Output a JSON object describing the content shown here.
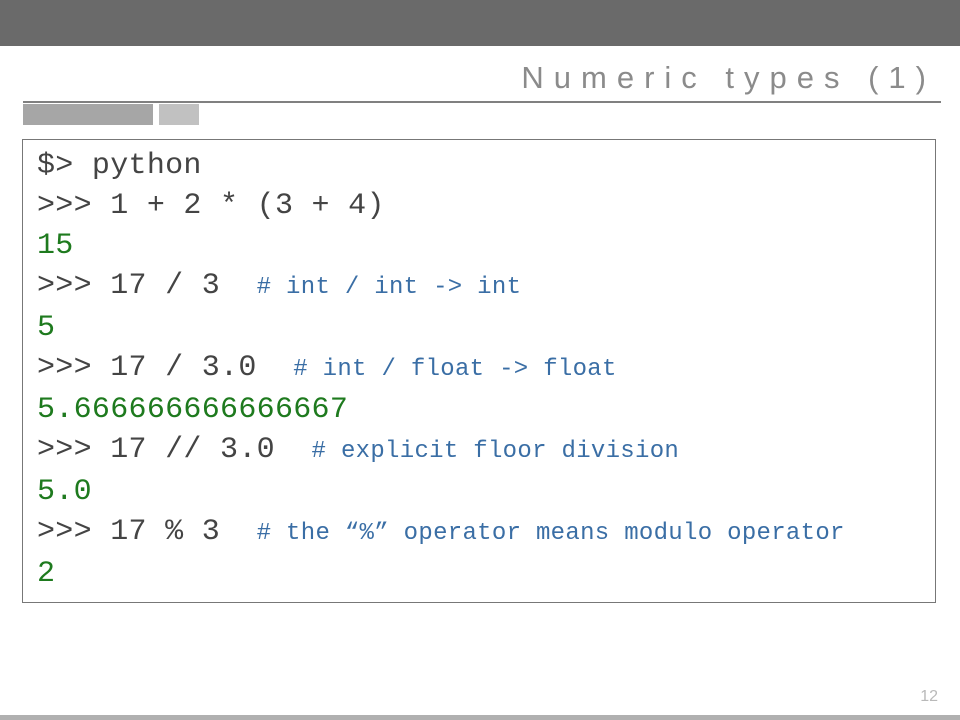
{
  "title": "Numeric types (1)",
  "page_number": "12",
  "code": {
    "l1": "$> python",
    "l2": ">>> 1 + 2 * (3 + 4)",
    "o1": "15",
    "l3a": ">>> 17 / 3  ",
    "l3c": "# int / int -> int",
    "o2": "5",
    "l4a": ">>> 17 / 3.0  ",
    "l4c": "# int / float -> float",
    "o3": "5.666666666666667",
    "l5a": ">>> 17 // 3.0  ",
    "l5c": "# explicit floor division",
    "o4": "5.0",
    "l6a": ">>> 17 % 3  ",
    "l6c": "# the “%” operator means modulo operator",
    "o5": "2"
  }
}
